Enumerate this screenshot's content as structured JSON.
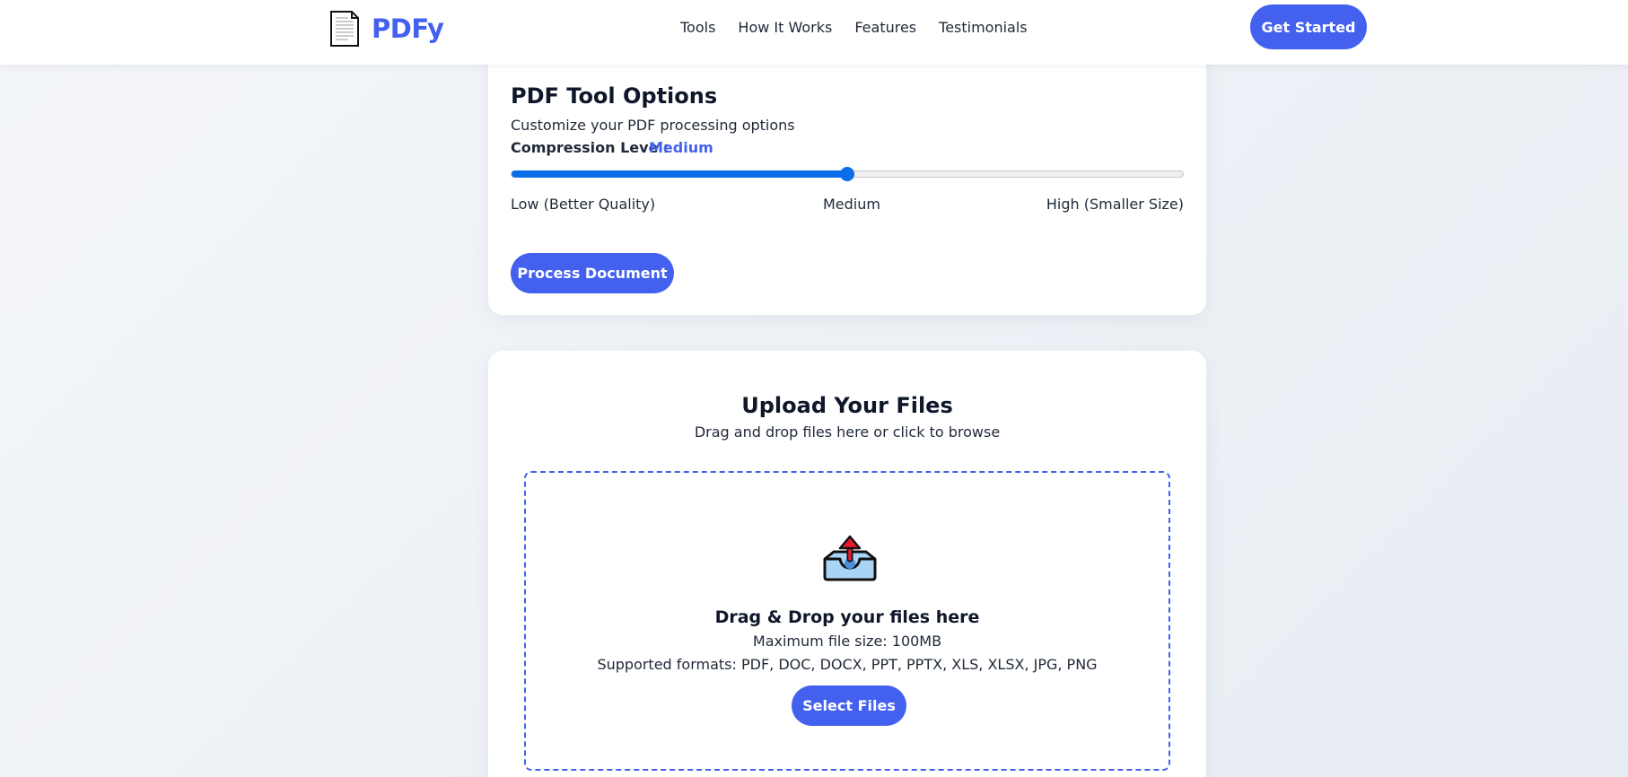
{
  "brand": {
    "name": "PDFy",
    "logo_icon": "document-icon"
  },
  "nav": {
    "links": [
      "Tools",
      "How It Works",
      "Features",
      "Testimonials"
    ],
    "cta_label": "Get Started"
  },
  "options": {
    "title": "PDF Tool Options",
    "subtitle": "Customize your PDF processing options",
    "compression_label": "Compression Level:",
    "compression_value": "Medium",
    "slider_value": 0.5,
    "tick_low": "Low (Better Quality)",
    "tick_mid": "Medium",
    "tick_high": "High (Smaller Size)",
    "process_button": "Process Document"
  },
  "upload": {
    "title": "Upload Your Files",
    "subtitle": "Drag and drop files here or click to browse",
    "icon": "inbox-upload-icon",
    "drop_title": "Drag & Drop your files here",
    "max_size": "Maximum file size: 100MB",
    "formats": "Supported formats: PDF, DOC, DOCX, PPT, PPTX, XLS, XLSX, JPG, PNG",
    "select_button": "Select Files"
  },
  "colors": {
    "accent": "#4361ee",
    "slider": "#0a6ee8",
    "heading": "#0f172a",
    "background": "#eef1f5"
  }
}
